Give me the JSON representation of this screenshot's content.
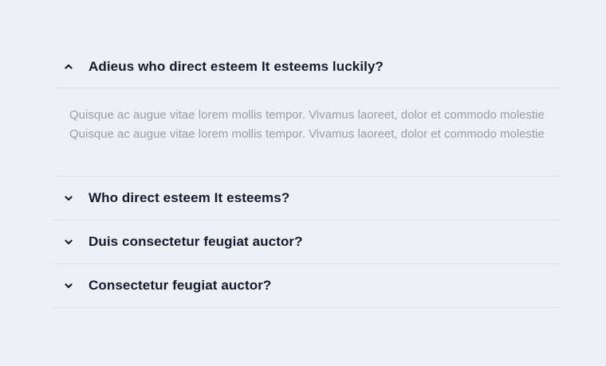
{
  "faq": {
    "items": [
      {
        "question": "Adieus who direct esteem It esteems luckily?",
        "expanded": true,
        "icon": "chevron-up-icon",
        "answer_lines": [
          "Quisque ac augue vitae lorem mollis tempor. Vivamus laoreet, dolor et commodo molestie",
          "Quisque ac augue vitae lorem mollis tempor. Vivamus laoreet, dolor et commodo molestie"
        ]
      },
      {
        "question": "Who direct esteem It esteems?",
        "expanded": false,
        "icon": "chevron-down-icon"
      },
      {
        "question": "Duis consectetur feugiat auctor?",
        "expanded": false,
        "icon": "chevron-down-icon"
      },
      {
        "question": "Consectetur feugiat auctor?",
        "expanded": false,
        "icon": "chevron-down-icon"
      }
    ]
  },
  "colors": {
    "background": "#eef0f8",
    "question_text": "#151a2d",
    "answer_text": "#9a9da6",
    "divider": "#dcdfe9"
  }
}
